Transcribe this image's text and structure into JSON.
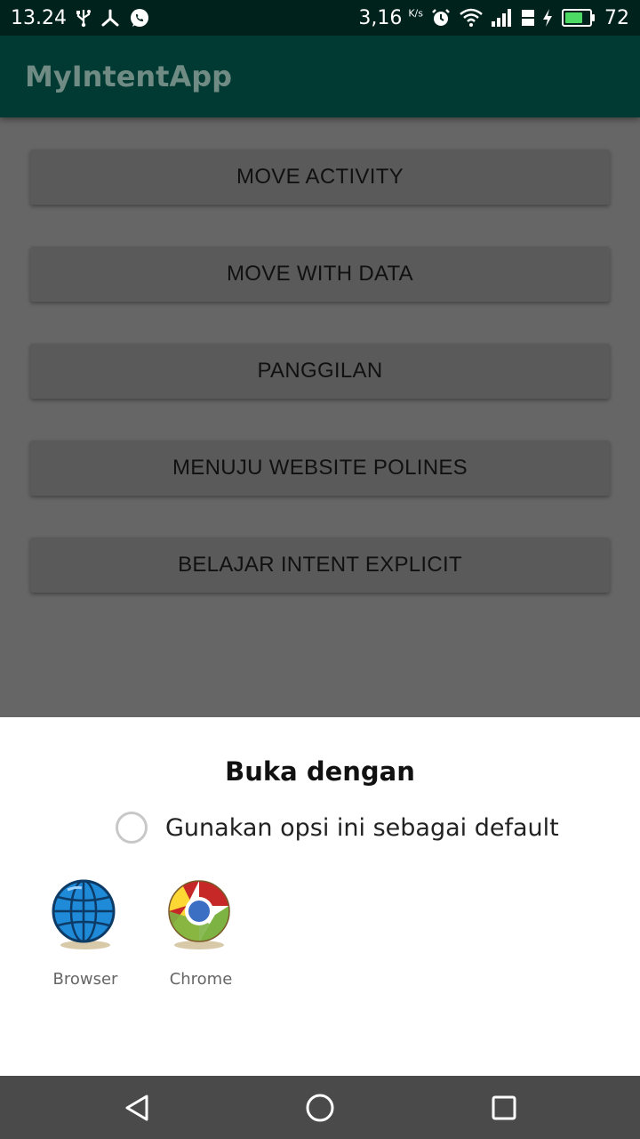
{
  "status_bar": {
    "time": "13.24",
    "network_speed": "3,16",
    "speed_unit": "K/s",
    "battery_level": 72,
    "battery_text": "72",
    "icons": [
      "usb-icon",
      "share-icon",
      "whatsapp-icon",
      "alarm-icon",
      "wifi-icon",
      "signal-icon",
      "lte-icon",
      "charging-icon",
      "battery-icon"
    ]
  },
  "app_bar": {
    "title": "MyIntentApp"
  },
  "buttons": [
    "MOVE ACTIVITY",
    "MOVE WITH DATA",
    "PANGGILAN",
    "MENUJU WEBSITE POLINES",
    "BELAJAR INTENT EXPLICIT"
  ],
  "chooser": {
    "title": "Buka dengan",
    "default_option_label": "Gunakan opsi ini sebagai default",
    "apps": [
      {
        "label": "Browser",
        "icon": "browser-globe-icon"
      },
      {
        "label": "Chrome",
        "icon": "chrome-icon"
      }
    ]
  },
  "nav_bar": {
    "icons": [
      "back-icon",
      "home-icon",
      "recents-icon"
    ]
  },
  "colors": {
    "status_bar": "#00221d",
    "app_bar": "#003a32",
    "dim_background": "#666666",
    "button": "#5a5a5a",
    "sheet": "#ffffff"
  }
}
